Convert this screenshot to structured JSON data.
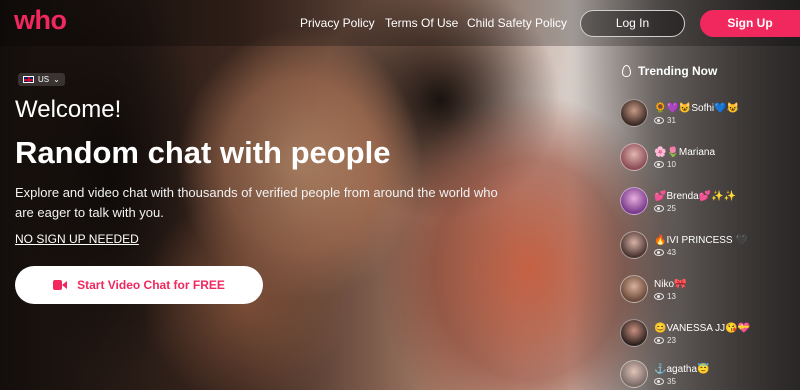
{
  "header": {
    "logo": "who",
    "nav": [
      "Privacy Policy",
      "Terms Of Use",
      "Child Safety Policy"
    ],
    "login_label": "Log In",
    "signup_label": "Sign Up"
  },
  "hero": {
    "locale": "US",
    "welcome": "Welcome!",
    "headline": "Random chat with people",
    "description": "Explore and video chat with thousands of verified people from around the world who are eager to talk with you.",
    "no_signup": "NO SIGN UP NEEDED",
    "cta_label": "Start Video Chat for FREE"
  },
  "trending": {
    "title": "Trending Now",
    "items": [
      {
        "name": "🌻💜😺Sofhi💙😺",
        "views": "31"
      },
      {
        "name": "🌸🌷Mariana",
        "views": "10"
      },
      {
        "name": "💕Brenda💕✨✨",
        "views": "25"
      },
      {
        "name": "🔥IVI PRINCESS 🖤",
        "views": "43"
      },
      {
        "name": "Niko🎀",
        "views": "13"
      },
      {
        "name": "😊VANESSA JJ😘💝",
        "views": "23"
      },
      {
        "name": "⚓agatha😇",
        "views": "35"
      }
    ]
  },
  "colors": {
    "brand": "#f0285e"
  }
}
